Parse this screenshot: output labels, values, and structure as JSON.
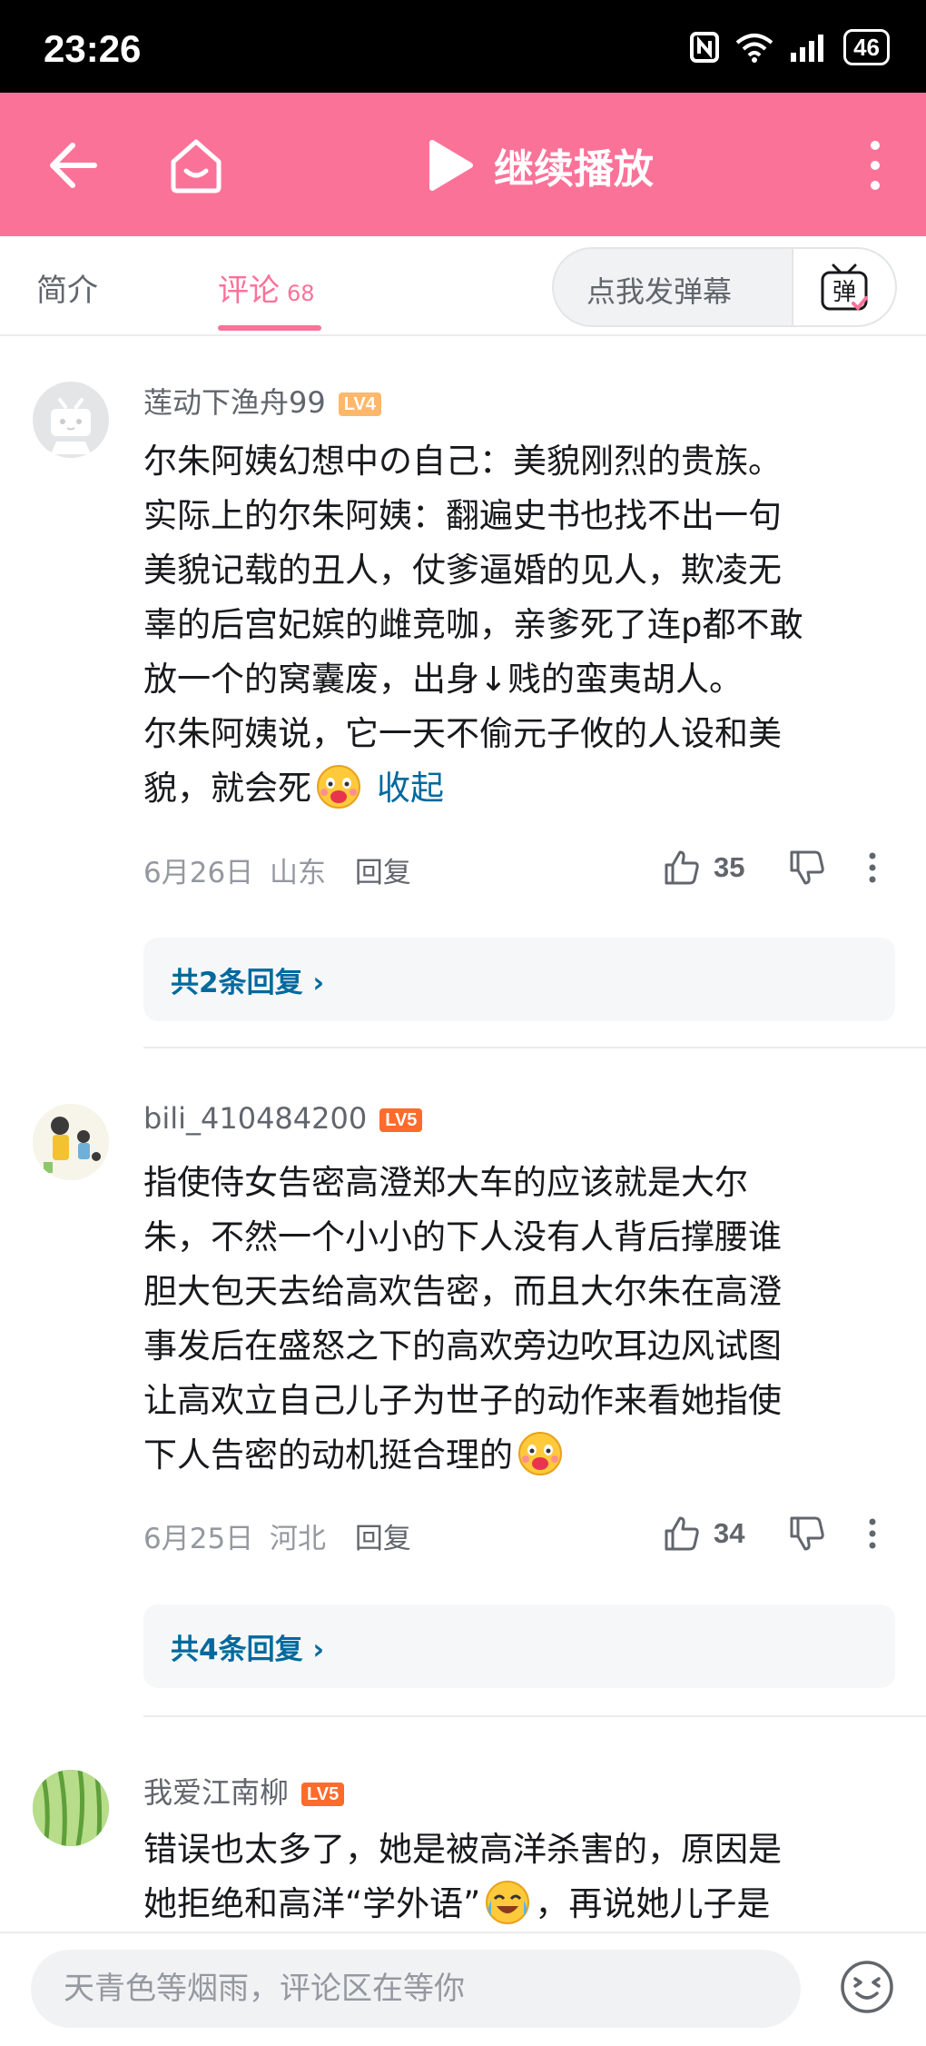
{
  "status_bar": {
    "time": "23:26",
    "battery": "46"
  },
  "top_bar": {
    "play_label": "继续播放"
  },
  "tabs": {
    "intro": "简介",
    "comments": "评论",
    "comments_count": "68"
  },
  "danmaku": {
    "placeholder": "点我发弹幕",
    "button_glyph": "弹"
  },
  "comments": [
    {
      "username": "莲动下渔舟99",
      "level": "LV4",
      "lines": [
        "尔朱阿姨幻想中の自己：美貌刚烈的贵族。",
        "实际上的尔朱阿姨：翻遍史书也找不出一句",
        "美貌记载的丑人，仗爹逼婚的见人，欺凌无",
        "辜的后宫妃嫔的雌竞咖，亲爹死了连p都不敢",
        "放一个的窝囊废，出身↓贱的蛮夷胡人。",
        "尔朱阿姨说，它一天不偷元子攸的人设和美",
        "貌，就会死"
      ],
      "collapse_label": "收起",
      "date": "6月26日",
      "location": "山东",
      "reply_label": "回复",
      "likes": "35",
      "replies_label": "共2条回复"
    },
    {
      "username": "bili_410484200",
      "level": "LV5",
      "lines": [
        "指使侍女告密高澄郑大车的应该就是大尔",
        "朱，不然一个小小的下人没有人背后撑腰谁",
        "胆大包天去给高欢告密，而且大尔朱在高澄",
        "事发后在盛怒之下的高欢旁边吹耳边风试图",
        "让高欢立自己儿子为世子的动作来看她指使",
        "下人告密的动机挺合理的"
      ],
      "date": "6月25日",
      "location": "河北",
      "reply_label": "回复",
      "likes": "34",
      "replies_label": "共4条回复"
    },
    {
      "username": "我爱江南柳",
      "level": "LV5",
      "lines": [
        "错误也太多了，她是被高洋杀害的，原因是",
        "她拒绝和高洋“学外语”",
        "，再说她儿子是"
      ]
    }
  ],
  "input_bar": {
    "placeholder": "天青色等烟雨，评论区在等你"
  },
  "colors": {
    "brand_pink": "#fb7299",
    "link_blue": "#00699d",
    "meta_gray": "#9499a0"
  }
}
